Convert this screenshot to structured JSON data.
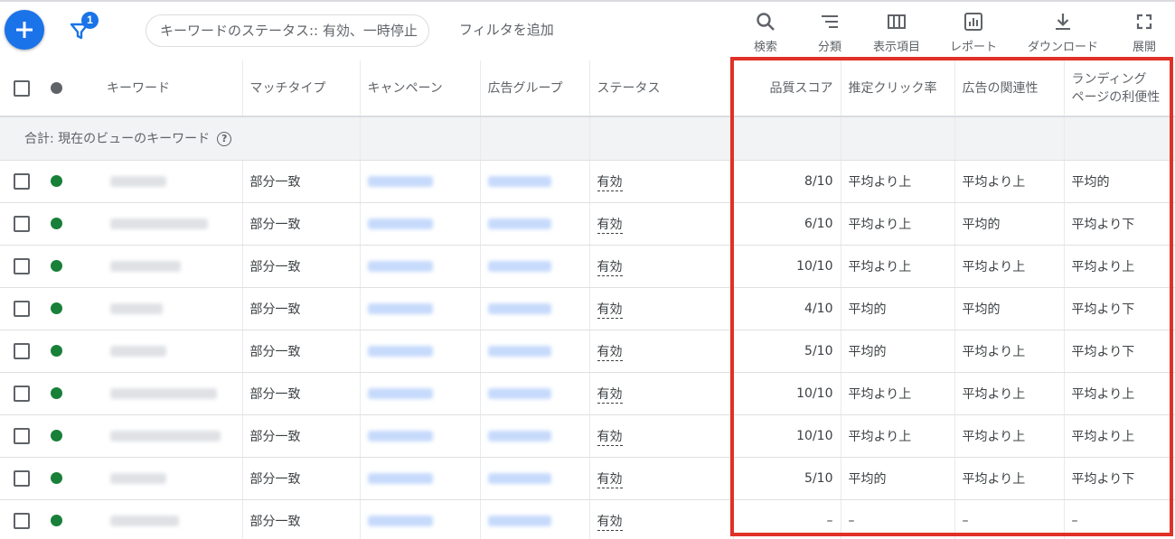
{
  "toolbar": {
    "filter_count": "1",
    "filter_chip": "キーワードのステータス:: 有効、一時停止",
    "add_filter": "フィルタを追加",
    "tools": [
      {
        "label": "検索",
        "icon": "search-icon"
      },
      {
        "label": "分類",
        "icon": "segment-icon"
      },
      {
        "label": "表示項目",
        "icon": "columns-icon"
      },
      {
        "label": "レポート",
        "icon": "report-icon"
      },
      {
        "label": "ダウンロード",
        "icon": "download-icon"
      },
      {
        "label": "展開",
        "icon": "expand-icon"
      }
    ]
  },
  "table": {
    "headers": {
      "keyword": "キーワード",
      "match_type": "マッチタイプ",
      "campaign": "キャンペーン",
      "ad_group": "広告グループ",
      "status": "ステータス",
      "quality_score": "品質スコア",
      "expected_ctr": "推定クリック率",
      "ad_relevance": "広告の関連性",
      "landing_page_line1": "ランディング",
      "landing_page_line2": "ページの利便性"
    },
    "total_label": "合計: 現在のビューのキーワード",
    "rows": [
      {
        "match": "部分一致",
        "status": "有効",
        "qs": "8/10",
        "ctr": "平均より上",
        "rel": "平均より上",
        "lp": "平均的"
      },
      {
        "match": "部分一致",
        "status": "有効",
        "qs": "6/10",
        "ctr": "平均より上",
        "rel": "平均的",
        "lp": "平均より下"
      },
      {
        "match": "部分一致",
        "status": "有効",
        "qs": "10/10",
        "ctr": "平均より上",
        "rel": "平均より上",
        "lp": "平均より上"
      },
      {
        "match": "部分一致",
        "status": "有効",
        "qs": "4/10",
        "ctr": "平均的",
        "rel": "平均的",
        "lp": "平均より下"
      },
      {
        "match": "部分一致",
        "status": "有効",
        "qs": "5/10",
        "ctr": "平均的",
        "rel": "平均より上",
        "lp": "平均より下"
      },
      {
        "match": "部分一致",
        "status": "有効",
        "qs": "10/10",
        "ctr": "平均より上",
        "rel": "平均より上",
        "lp": "平均より上"
      },
      {
        "match": "部分一致",
        "status": "有効",
        "qs": "10/10",
        "ctr": "平均より上",
        "rel": "平均より上",
        "lp": "平均より上"
      },
      {
        "match": "部分一致",
        "status": "有効",
        "qs": "5/10",
        "ctr": "平均的",
        "rel": "平均より上",
        "lp": "平均より下"
      },
      {
        "match": "部分一致",
        "status": "有効",
        "qs": "–",
        "ctr": "–",
        "rel": "–",
        "lp": "–"
      }
    ]
  },
  "colors": {
    "accent": "#1a73e8",
    "enabled_dot": "#188038",
    "highlight_box": "#e03127"
  }
}
